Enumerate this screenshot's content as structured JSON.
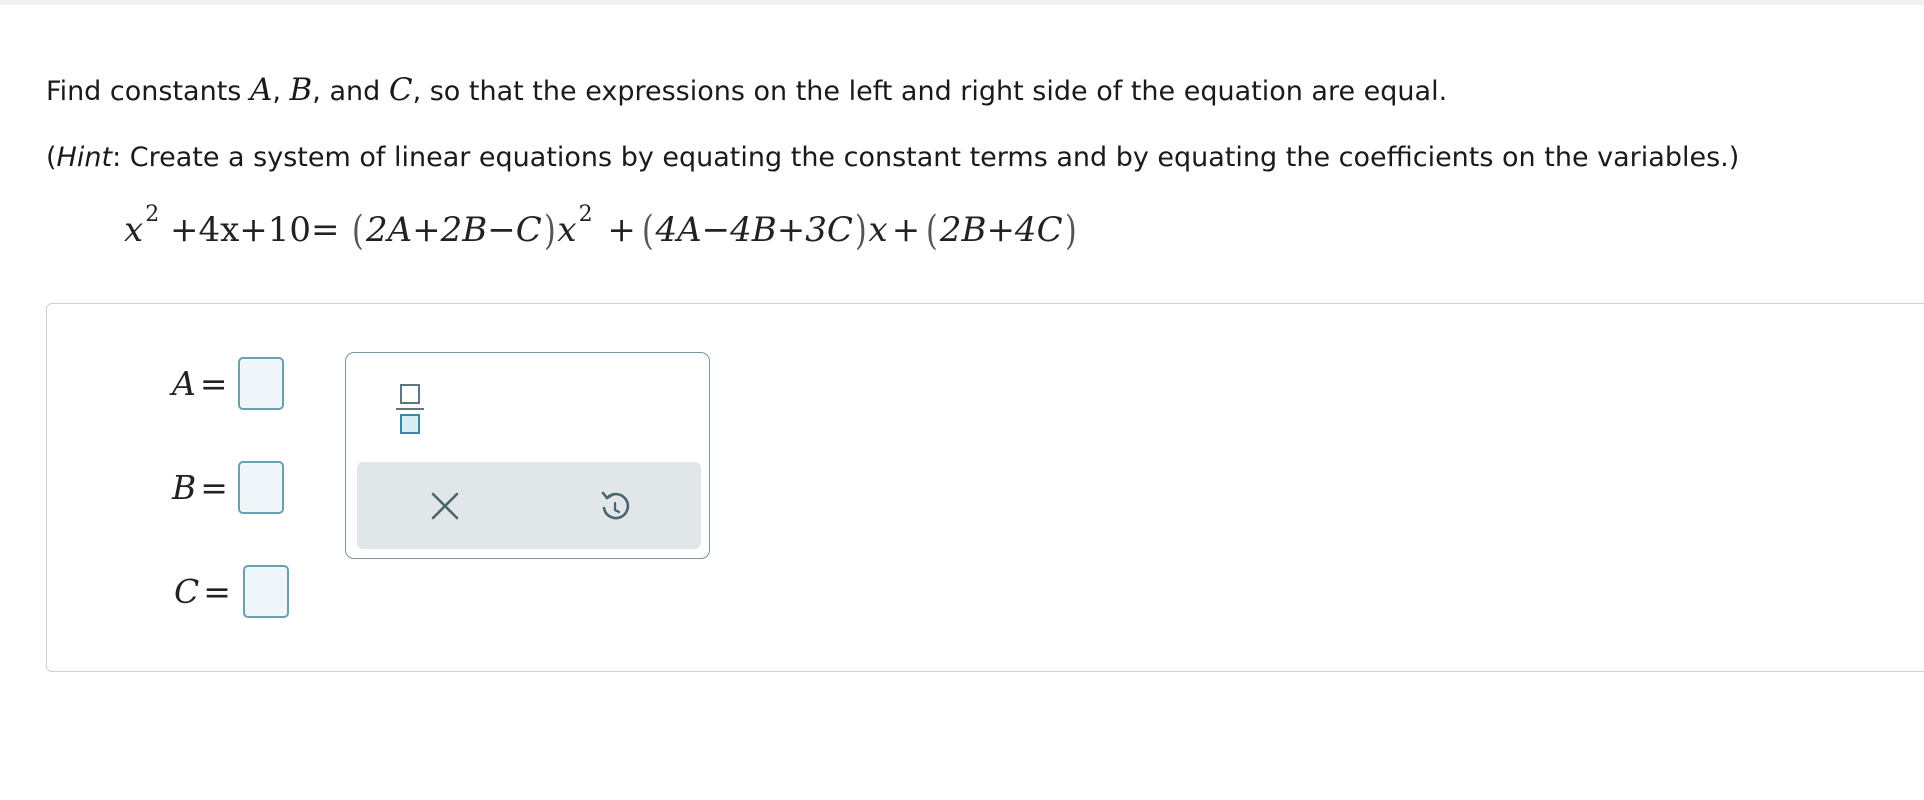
{
  "question": {
    "prefix": "Find constants ",
    "var_a": "A",
    "sep1": ", ",
    "var_b": "B",
    "sep2": ", and ",
    "var_c": "C",
    "suffix": ", so that the expressions on the left and right side of the equation are equal."
  },
  "hint": {
    "open": "(",
    "label": "Hint",
    "text": ": Create a system of linear equations by equating the constant terms and by equating the coefficients on the variables.)"
  },
  "equation": {
    "lhs_x": "x",
    "lhs_exp": "2",
    "lhs_rest": "+4x+10=",
    "term1": "2A+2B−C",
    "term1_var": "x",
    "term1_exp": "2",
    "plus1": "+",
    "term2": "4A−4B+3C",
    "term2_var": "x",
    "plus2": "+",
    "term3": "2B+4C"
  },
  "answers": [
    {
      "label": "A",
      "equals": "=",
      "value": ""
    },
    {
      "label": "B",
      "equals": "=",
      "value": ""
    },
    {
      "label": "C",
      "equals": "=",
      "value": ""
    }
  ],
  "palette": {
    "buttons": [
      "fraction-icon",
      "clear-icon",
      "undo-icon"
    ]
  },
  "colors": {
    "input_border": "#6b9eae",
    "input_fill": "#eef6f9",
    "palette_bar": "#e1e6e9",
    "icon": "#4a6470"
  }
}
